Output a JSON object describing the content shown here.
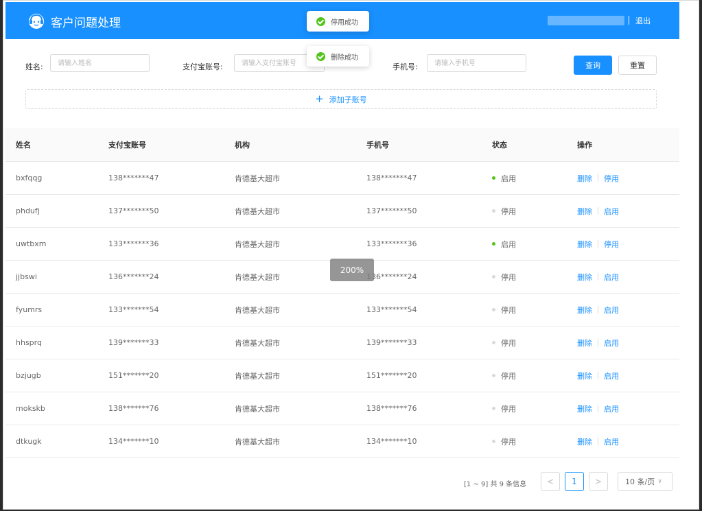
{
  "header": {
    "title": "客户问题处理",
    "logout_label": "退出"
  },
  "toasts": [
    {
      "text": "停用成功"
    },
    {
      "text": "删除成功"
    }
  ],
  "filters": {
    "name_label": "姓名:",
    "name_placeholder": "请输入姓名",
    "alipay_label": "支付宝账号:",
    "alipay_placeholder": "请输入支付宝账号",
    "phone_label": "手机号:",
    "phone_placeholder": "请输入手机号",
    "query_label": "查询",
    "reset_label": "重置"
  },
  "add_sub_account_label": "添加子账号",
  "table": {
    "columns": [
      "姓名",
      "支付宝账号",
      "机构",
      "手机号",
      "状态",
      "操作"
    ],
    "rows": [
      {
        "name": "bxfqqg",
        "alipay": "138*******47",
        "org": "肯德基大超市",
        "phone": "138*******47",
        "status": "启用",
        "active": true,
        "op_delete": "删除",
        "op_toggle": "停用"
      },
      {
        "name": "phdufj",
        "alipay": "137*******50",
        "org": "肯德基大超市",
        "phone": "137*******50",
        "status": "停用",
        "active": false,
        "op_delete": "删除",
        "op_toggle": "启用"
      },
      {
        "name": "uwtbxm",
        "alipay": "133*******36",
        "org": "肯德基大超市",
        "phone": "133*******36",
        "status": "启用",
        "active": true,
        "op_delete": "删除",
        "op_toggle": "停用"
      },
      {
        "name": "jjbswi",
        "alipay": "136*******24",
        "org": "肯德基大超市",
        "phone": "136*******24",
        "status": "停用",
        "active": false,
        "op_delete": "删除",
        "op_toggle": "启用"
      },
      {
        "name": "fyumrs",
        "alipay": "133*******54",
        "org": "肯德基大超市",
        "phone": "133*******54",
        "status": "停用",
        "active": false,
        "op_delete": "删除",
        "op_toggle": "启用"
      },
      {
        "name": "hhsprq",
        "alipay": "139*******33",
        "org": "肯德基大超市",
        "phone": "139*******33",
        "status": "停用",
        "active": false,
        "op_delete": "删除",
        "op_toggle": "启用"
      },
      {
        "name": "bzjugb",
        "alipay": "151*******20",
        "org": "肯德基大超市",
        "phone": "151*******20",
        "status": "停用",
        "active": false,
        "op_delete": "删除",
        "op_toggle": "启用"
      },
      {
        "name": "mokskb",
        "alipay": "138*******76",
        "org": "肯德基大超市",
        "phone": "138*******76",
        "status": "停用",
        "active": false,
        "op_delete": "删除",
        "op_toggle": "启用"
      },
      {
        "name": "dtkugk",
        "alipay": "134*******10",
        "org": "肯德基大超市",
        "phone": "134*******10",
        "status": "停用",
        "active": false,
        "op_delete": "删除",
        "op_toggle": "启用"
      }
    ]
  },
  "zoom_indicator": "200%",
  "pagination": {
    "info": "[1 ~ 9] 共 9 条信息",
    "prev": "<",
    "current_page": "1",
    "next": ">",
    "page_size": "10 条/页"
  },
  "colors": {
    "accent": "#1890ff",
    "active_dot": "#52c41a",
    "inactive_dot": "#d9d9d9"
  }
}
